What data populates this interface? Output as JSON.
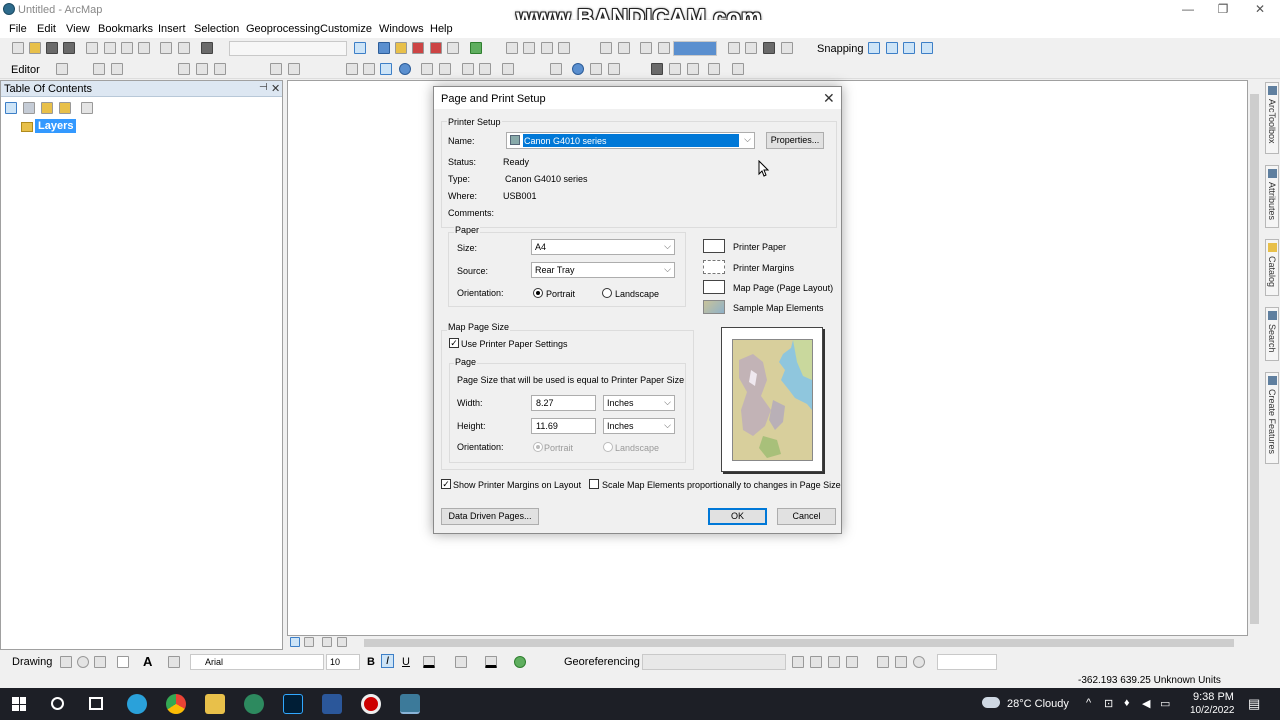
{
  "window": {
    "title": "Untitled - ArcMap",
    "watermark": "www.BANDICAM.com"
  },
  "menubar": [
    "File",
    "Edit",
    "View",
    "Bookmarks",
    "Insert",
    "Selection",
    "Geoprocessing",
    "Customize",
    "Windows",
    "Help"
  ],
  "toolbar": {
    "snapping_label": "Snapping",
    "editor_label": "Editor"
  },
  "toc": {
    "title": "Table Of Contents",
    "layers_label": "Layers"
  },
  "right_dock": [
    "ArcToolbox",
    "Attributes",
    "Catalog",
    "Search",
    "Create Features"
  ],
  "drawing_toolbar": {
    "drawing_label": "Drawing",
    "font_name": "Arial",
    "font_size": "10",
    "bold": "B",
    "italic": "I",
    "underline": "U",
    "georef_label": "Georeferencing",
    "text_A": "A"
  },
  "status": {
    "coordinates": "-362.193  639.25 Unknown Units"
  },
  "dialog": {
    "title": "Page and Print Setup",
    "printer_setup": {
      "section": "Printer Setup",
      "name_label": "Name:",
      "name_value": "Canon G4010 series",
      "properties_button": "Properties...",
      "status_label": "Status:",
      "status_value": "Ready",
      "type_label": "Type:",
      "type_value": "Canon G4010 series",
      "where_label": "Where:",
      "where_value": "USB001",
      "comments_label": "Comments:"
    },
    "paper": {
      "section": "Paper",
      "size_label": "Size:",
      "size_value": "A4",
      "source_label": "Source:",
      "source_value": "Rear Tray",
      "orientation_label": "Orientation:",
      "portrait": "Portrait",
      "landscape": "Landscape",
      "selected": "Portrait"
    },
    "legend": {
      "printer_paper": "Printer Paper",
      "printer_margins": "Printer Margins",
      "map_page": "Map Page (Page Layout)",
      "sample_map": "Sample Map Elements"
    },
    "map_page_size": {
      "section": "Map Page Size",
      "use_printer_settings": "Use Printer Paper Settings",
      "use_printer_settings_checked": true,
      "page_section": "Page",
      "page_desc": "Page Size that will be used is equal to Printer Paper Size",
      "width_label": "Width:",
      "width_value": "8.27",
      "width_unit": "Inches",
      "height_label": "Height:",
      "height_value": "11.69",
      "height_unit": "Inches",
      "orientation_label": "Orientation:",
      "portrait": "Portrait",
      "landscape": "Landscape"
    },
    "show_margins": "Show Printer Margins on Layout",
    "show_margins_checked": true,
    "scale_elements": "Scale Map Elements proportionally to changes in Page Size",
    "scale_elements_checked": false,
    "data_driven_button": "Data Driven Pages...",
    "ok_button": "OK",
    "cancel_button": "Cancel"
  },
  "taskbar": {
    "weather": "28°C  Cloudy",
    "time": "9:38 PM",
    "date": "10/2/2022"
  },
  "colors": {
    "selection": "#3399ff",
    "accent": "#0078d7",
    "toc_header": "#dde7f2",
    "taskbar": "#1d1f26"
  }
}
